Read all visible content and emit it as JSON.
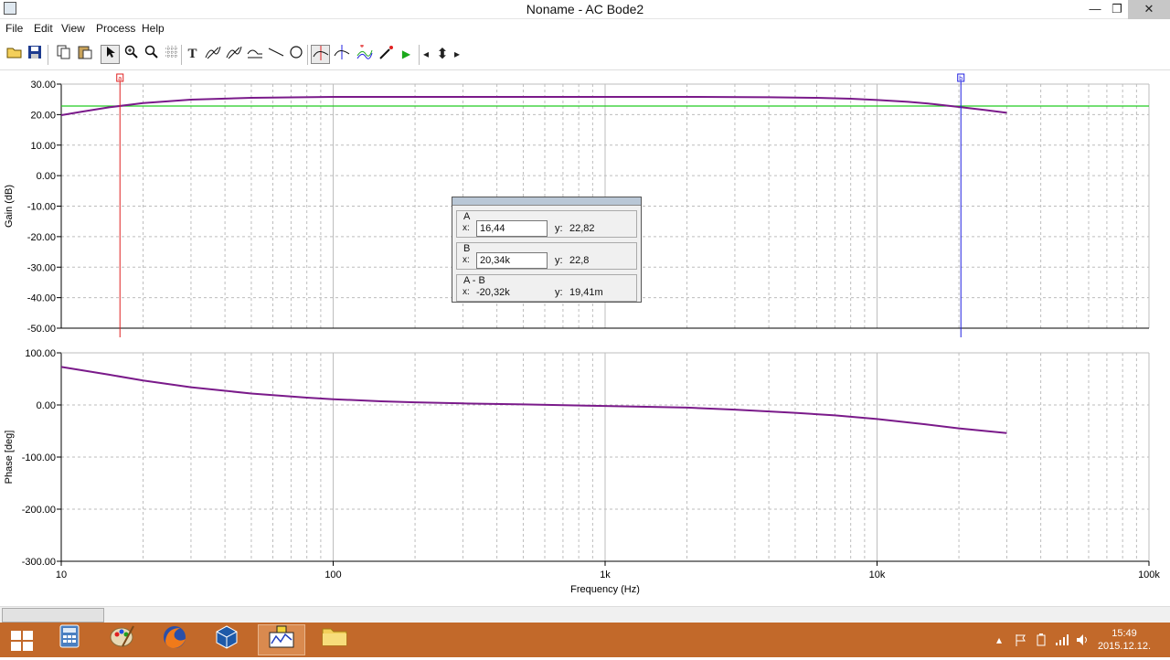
{
  "window": {
    "title": "Noname - AC Bode2",
    "minimize": "—",
    "maximize": "❐",
    "close": "✕"
  },
  "menu": [
    "File",
    "Edit",
    "View",
    "Process",
    "Help"
  ],
  "toolbar": {
    "open_icon": "open-folder-icon",
    "save_icon": "save-icon",
    "copy_icon": "copy-icon",
    "paste_icon": "paste-icon",
    "pointer_icon": "pointer-icon",
    "zoom_icon": "zoom-icon",
    "zoom100_icon": "zoom-100-icon",
    "grid_icon": "grid-icon",
    "text_icon": "text-tool-icon",
    "text_glyph": "T",
    "run_icon": "run-icon",
    "run_glyph": "▶",
    "left_glyph": "◂",
    "updown_glyph": "⬍",
    "right_glyph": "▸"
  },
  "cursor_panel": {
    "a": {
      "label": "A",
      "x_label": "x:",
      "x_value": "16,44",
      "y_label": "y:",
      "y_value": "22,82"
    },
    "b": {
      "label": "B",
      "x_label": "x:",
      "x_value": "20,34k",
      "y_label": "y:",
      "y_value": "22,8"
    },
    "diff": {
      "label": "A - B",
      "x_label": "x:",
      "x_value": "-20,32k",
      "y_label": "y:",
      "y_value": "19,41m"
    }
  },
  "colors": {
    "trace": "#7a1a8a",
    "reference": "#22cc22",
    "cursor_a": "#e02020",
    "cursor_b": "#2020e0",
    "grid": "#bdbdbd",
    "taskbar": "#c2692a"
  },
  "chart_data": [
    {
      "type": "line",
      "ylabel": "Gain (dB)",
      "ylim": [
        -50,
        30
      ],
      "yticks": [
        "30.00",
        "20.00",
        "10.00",
        "0.00",
        "-10.00",
        "-20.00",
        "-30.00",
        "-40.00",
        "-50.00"
      ],
      "xscale": "log",
      "xlim": [
        10,
        100000
      ],
      "grid": true,
      "cursors": [
        {
          "label": "a",
          "x": 16.44
        },
        {
          "label": "b",
          "x": 20340
        }
      ],
      "reference_line": {
        "y": 22.8
      },
      "series": [
        {
          "x": [
            10,
            12,
            15,
            20,
            30,
            50,
            100,
            200,
            500,
            1000,
            2000,
            4000,
            6000,
            8000,
            10000,
            13000,
            16000,
            20000,
            25000,
            30000
          ],
          "y": [
            19.8,
            21.0,
            22.4,
            23.8,
            24.9,
            25.5,
            25.8,
            25.8,
            25.8,
            25.8,
            25.8,
            25.7,
            25.5,
            25.2,
            24.8,
            24.2,
            23.5,
            22.5,
            21.5,
            20.6
          ]
        }
      ]
    },
    {
      "type": "line",
      "ylabel": "Phase [deg]",
      "xlabel": "Frequency (Hz)",
      "ylim": [
        -300,
        100
      ],
      "yticks": [
        "100.00",
        "0.00",
        "-100.00",
        "-200.00",
        "-300.00"
      ],
      "xscale": "log",
      "xlim": [
        10,
        100000
      ],
      "xticks": [
        10,
        100,
        1000,
        10000,
        100000
      ],
      "xtick_labels": [
        "10",
        "100",
        "1k",
        "10k",
        "100k"
      ],
      "grid": true,
      "series": [
        {
          "x": [
            10,
            15,
            20,
            30,
            50,
            80,
            100,
            150,
            200,
            300,
            500,
            1000,
            2000,
            3000,
            5000,
            7000,
            10000,
            15000,
            20000,
            30000
          ],
          "y": [
            73,
            58,
            47,
            34,
            22,
            14,
            11,
            7,
            5,
            3,
            1,
            -2,
            -5,
            -9,
            -15,
            -20,
            -27,
            -37,
            -45,
            -54
          ]
        }
      ]
    }
  ]
}
